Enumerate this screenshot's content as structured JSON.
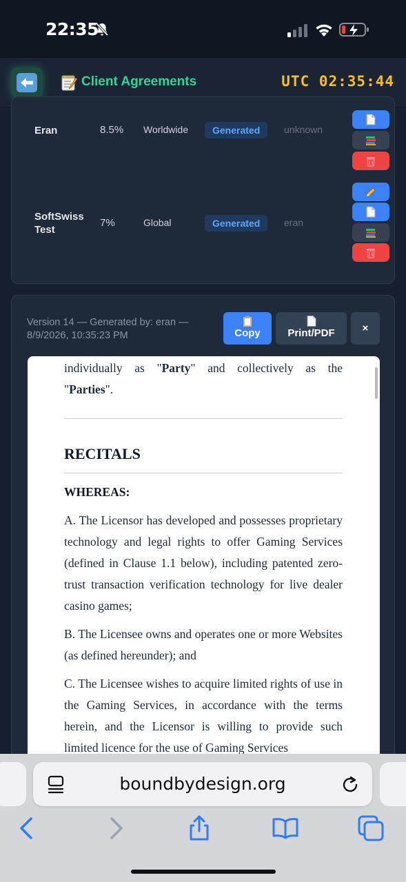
{
  "status_bar": {
    "time": "22:35"
  },
  "header": {
    "title": "Client Agreements",
    "clock": "UTC 02:35:44"
  },
  "agreements": [
    {
      "name": "Eran",
      "share": "8.5%",
      "region": "Worldwide",
      "status": "Generated",
      "generated_by": "unknown"
    },
    {
      "name": "SoftSwiss Test",
      "share": "7%",
      "region": "Global",
      "status": "Generated",
      "generated_by": "eran"
    }
  ],
  "preview": {
    "version_info": "Version 14 — Generated by: eran — 8/9/2026, 10:35:23 PM",
    "copy_label": "Copy",
    "print_label": "Print/PDF",
    "close_label": "×"
  },
  "document": {
    "intro_line1": "individually as \"",
    "party": "Party",
    "intro_line2": "\" and collectively as the",
    "parties_open": "\"",
    "parties": "Parties",
    "parties_close": "\".",
    "recitals_heading": "RECITALS",
    "whereas": "WHEREAS:",
    "recital_a": "A. The Licensor has developed and possesses proprietary technology and legal rights to offer Gaming Services (defined in Clause 1.1 below), including patented zero-trust transaction verification technology for live dealer casino games;",
    "recital_b": "B. The Licensee owns and operates one or more Websites (as defined hereunder); and",
    "recital_c": "C. The Licensee wishes to acquire limited rights of use in the Gaming Services, in accordance with the terms herein, and the Licensor is willing to provide such limited licence for the use of Gaming Services"
  },
  "browser": {
    "url": "boundbydesign.org"
  }
}
